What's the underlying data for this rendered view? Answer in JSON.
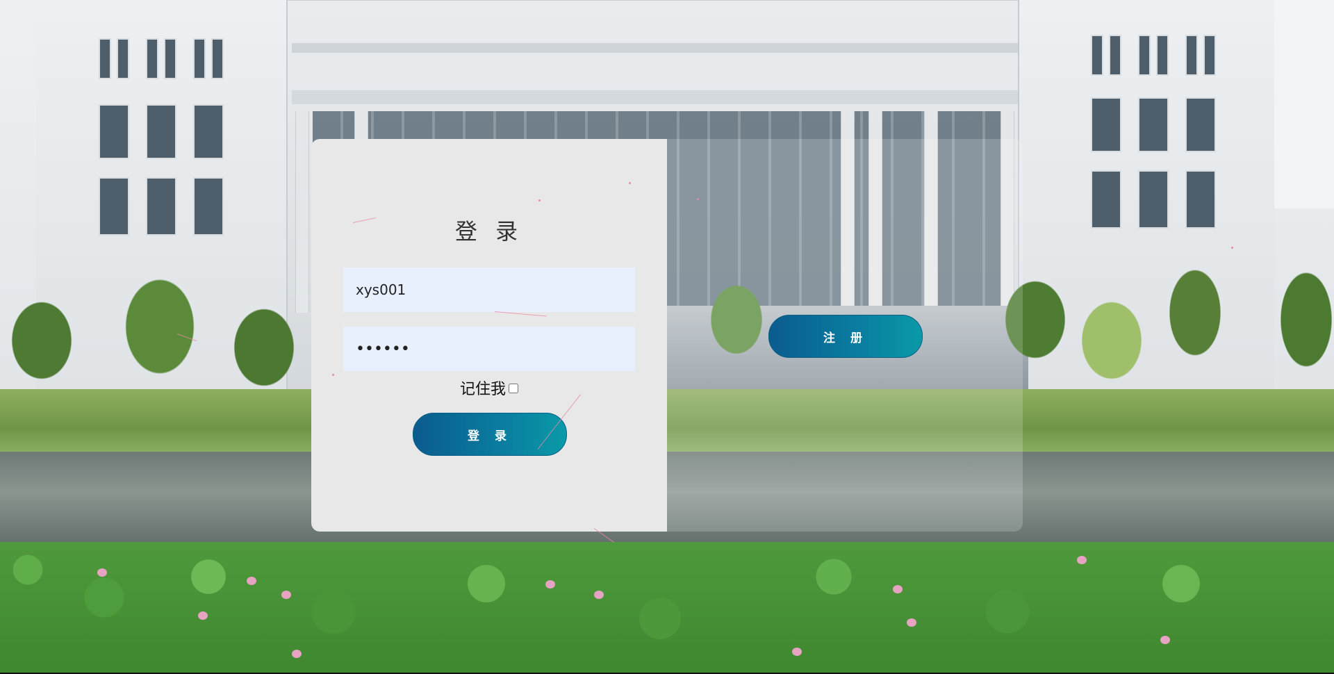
{
  "login": {
    "title": "登 录",
    "username_value": "xys001",
    "password_value": "123456",
    "remember_label": "记住我",
    "remember_checked": false,
    "login_button": "登 录"
  },
  "register": {
    "register_button": "注 册"
  },
  "colors": {
    "button_gradient_start": "#0b5c8e",
    "button_gradient_end": "#0a9aa8",
    "panel_bg": "#e8e8e8",
    "input_bg": "#e8f0fe"
  }
}
